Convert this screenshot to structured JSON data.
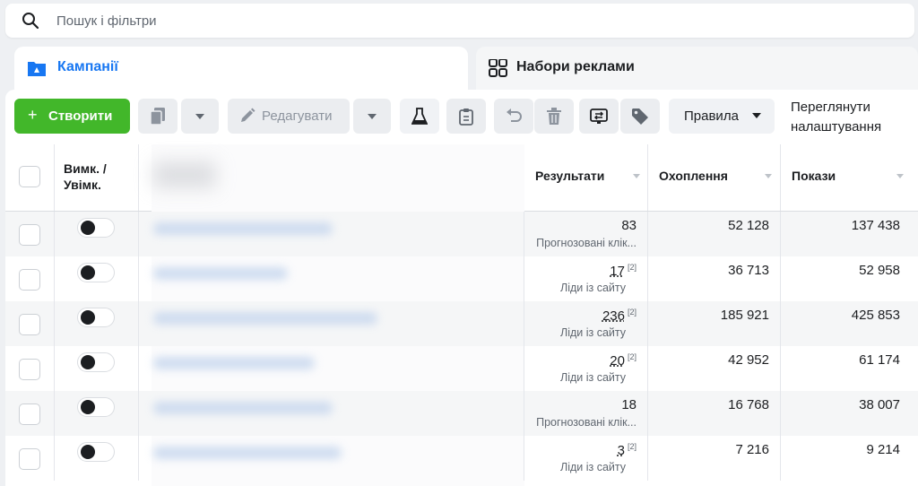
{
  "search": {
    "placeholder": "Пошук і фільтри",
    "icon": "search-icon"
  },
  "tabs": [
    {
      "label": "Кампанії",
      "icon": "campaign-folder-icon",
      "active": true
    },
    {
      "label": "Набори реклами",
      "icon": "ad-sets-grid-icon",
      "active": false
    }
  ],
  "toolbar": {
    "create_label": "Створити",
    "edit_label": "Редагувати",
    "rules_label": "Правила",
    "view_settings_line1": "Переглянути",
    "view_settings_line2": "налаштування"
  },
  "colors": {
    "accent": "#1877f2",
    "create": "#42b72a",
    "row_alt": "#f5f6f7"
  },
  "columns": {
    "toggle_line1": "Вимк. /",
    "toggle_line2": "Увімк.",
    "results": "Результати",
    "reach": "Охоплення",
    "impressions": "Покази"
  },
  "rows": [
    {
      "results": "83",
      "results_note": "",
      "results_type": "Прогнозовані клік...",
      "reach": "52 128",
      "impressions": "137 438"
    },
    {
      "results": "17",
      "results_note": "[2]",
      "results_type": "Ліди із сайту",
      "reach": "36 713",
      "impressions": "52 958"
    },
    {
      "results": "236",
      "results_note": "[2]",
      "results_type": "Ліди із сайту",
      "reach": "185 921",
      "impressions": "425 853"
    },
    {
      "results": "20",
      "results_note": "[2]",
      "results_type": "Ліди із сайту",
      "reach": "42 952",
      "impressions": "61 174"
    },
    {
      "results": "18",
      "results_note": "",
      "results_type": "Прогнозовані клік...",
      "reach": "16 768",
      "impressions": "38 007"
    },
    {
      "results": "3",
      "results_note": "[2]",
      "results_type": "Ліди із сайту",
      "reach": "7 216",
      "impressions": "9 214"
    }
  ]
}
